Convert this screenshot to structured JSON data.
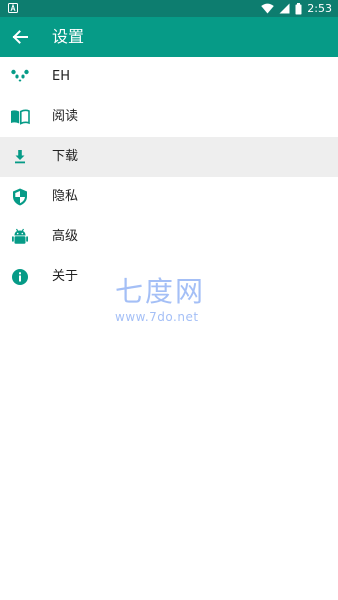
{
  "status_bar": {
    "time": "2:53"
  },
  "app_bar": {
    "title": "设置"
  },
  "items": [
    {
      "label": "EH",
      "icon": "panda-icon"
    },
    {
      "label": "阅读",
      "icon": "book-icon"
    },
    {
      "label": "下载",
      "icon": "download-icon",
      "selected": true
    },
    {
      "label": "隐私",
      "icon": "shield-icon"
    },
    {
      "label": "高级",
      "icon": "android-icon"
    },
    {
      "label": "关于",
      "icon": "info-icon"
    }
  ],
  "watermark": {
    "main": "七度网",
    "url": "www.7do.net"
  },
  "colors": {
    "status_bar": "#0d7d6f",
    "app_bar": "#069b87",
    "accent": "#069b87",
    "selected_row": "#eeeeee"
  }
}
